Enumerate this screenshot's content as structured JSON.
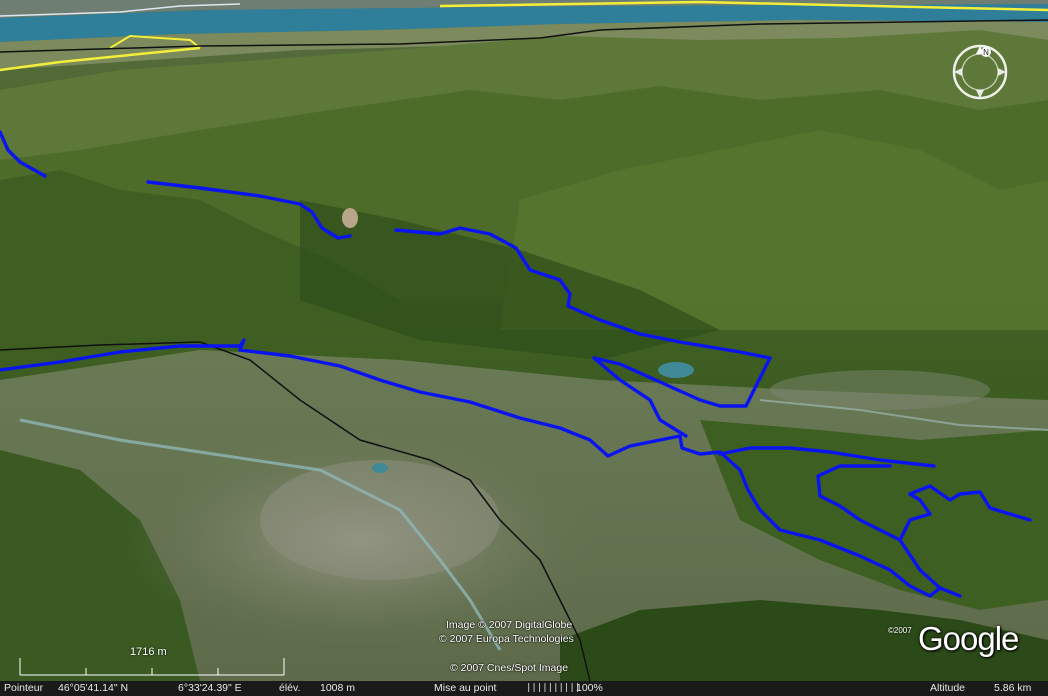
{
  "attribution": {
    "line1": "Image © 2007 DigitalGlobe",
    "line2": "© 2007 Europa Technologies",
    "line3": "© 2007 Cnes/Spot Image"
  },
  "logo": {
    "copyright": "©2007",
    "word": "Google"
  },
  "compass": {
    "icon": "compass-icon",
    "north_label": "N"
  },
  "scale": {
    "label": "1716 m"
  },
  "status": {
    "pointer_label": "Pointeur",
    "latitude": "46°05'41.14\" N",
    "longitude": "6°33'24.39\" E",
    "elevation_label": "élév.",
    "elevation": "1008 m",
    "streaming_label": "Mise au point",
    "streaming_bars": "||||||||||",
    "streaming_percent": "100%",
    "altitude_label": "Altitude",
    "altitude": "5.86 km"
  },
  "colors": {
    "track": "#0a14f0",
    "road_yellow": "#f2ee3a",
    "lake": "#2f7f9a",
    "border_black": "#111111"
  }
}
